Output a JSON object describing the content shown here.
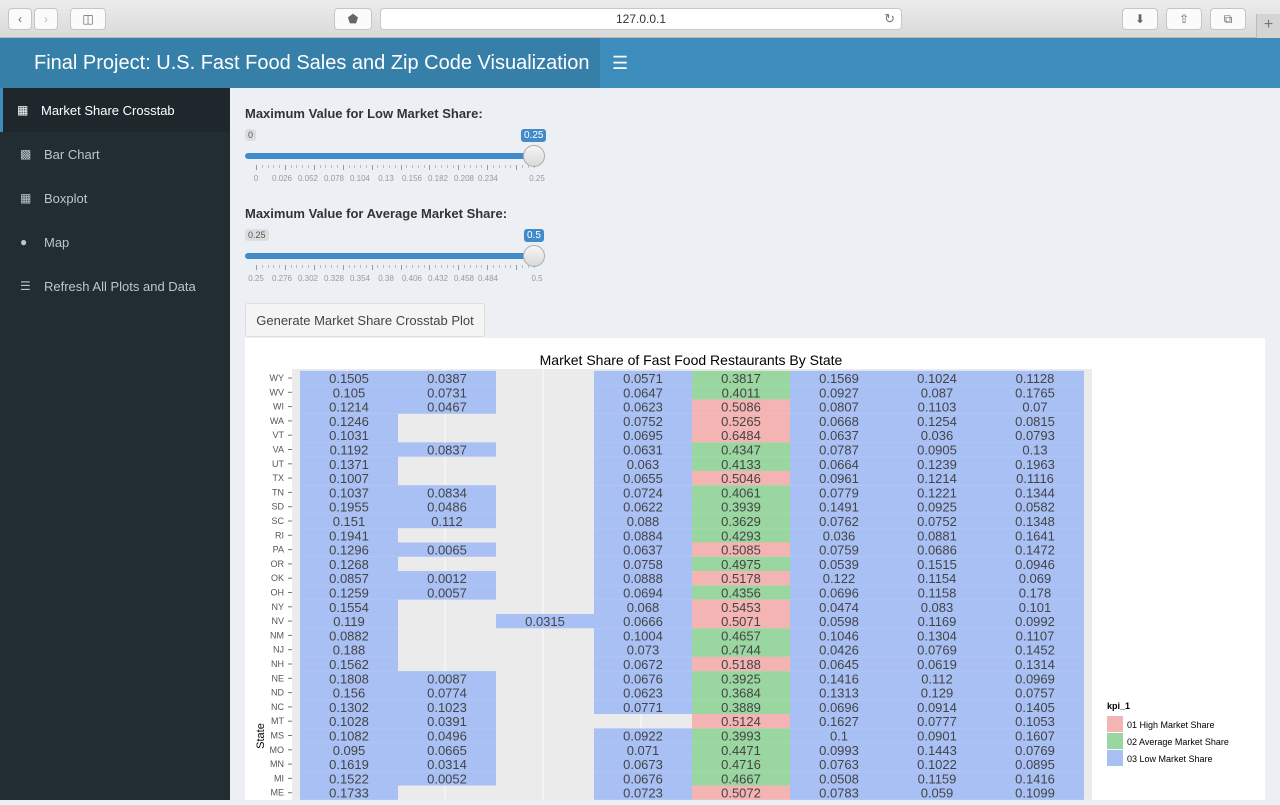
{
  "browser": {
    "url": "127.0.0.1"
  },
  "header": {
    "title": "Final Project: U.S. Fast Food Sales and Zip Code Visualization",
    "toggle_icon": "hamburger-icon"
  },
  "sidebar": {
    "items": [
      {
        "label": "Market Share Crosstab",
        "icon": "grid-icon",
        "active": true
      },
      {
        "label": "Bar Chart",
        "icon": "bar-chart-icon",
        "active": false
      },
      {
        "label": "Boxplot",
        "icon": "grid-icon",
        "active": false
      },
      {
        "label": "Map",
        "icon": "map-marker-icon",
        "active": false
      },
      {
        "label": "Refresh All Plots and Data",
        "icon": "database-icon",
        "active": false
      }
    ]
  },
  "sliders": [
    {
      "label": "Maximum Value for Low Market Share:",
      "min_label": "0",
      "value_label": "0.25",
      "value": 0.25,
      "min": 0,
      "max": 0.25,
      "tick_labels": [
        "0",
        "0.026",
        "0.052",
        "0.078",
        "0.104",
        "0.13",
        "0.156",
        "0.182",
        "0.208",
        "0.234",
        "0.25"
      ]
    },
    {
      "label": "Maximum Value for Average Market Share:",
      "min_label": "0.25",
      "value_label": "0.5",
      "value": 0.5,
      "min": 0.25,
      "max": 0.5,
      "tick_labels": [
        "0.25",
        "0.276",
        "0.302",
        "0.328",
        "0.354",
        "0.38",
        "0.406",
        "0.432",
        "0.458",
        "0.484",
        "0.5"
      ]
    }
  ],
  "generate_button": "Generate Market Share Crosstab Plot",
  "colors": {
    "high": "#f4b4b4",
    "average": "#99d6a0",
    "low": "#a9c0f5",
    "empty": "#ebebeb"
  },
  "chart_data": {
    "type": "heatmap",
    "title": "Market Share of Fast Food Restaurants By State",
    "ylabel": "State",
    "legend_title": "kpi_1",
    "legend": [
      {
        "label": "01 High Market Share",
        "key": "high"
      },
      {
        "label": "02 Average Market Share",
        "key": "average"
      },
      {
        "label": "03 Low Market Share",
        "key": "low"
      }
    ],
    "rows": [
      {
        "state": "WY",
        "cells": [
          "0.1505",
          "0.0387",
          null,
          "0.0571",
          "0.3817",
          "0.1569",
          "0.1024",
          "0.1128"
        ],
        "kpi": [
          "low",
          "low",
          null,
          "low",
          "average",
          "low",
          "low",
          "low"
        ]
      },
      {
        "state": "WV",
        "cells": [
          "0.105",
          "0.0731",
          null,
          "0.0647",
          "0.4011",
          "0.0927",
          "0.087",
          "0.1765"
        ],
        "kpi": [
          "low",
          "low",
          null,
          "low",
          "average",
          "low",
          "low",
          "low"
        ]
      },
      {
        "state": "WI",
        "cells": [
          "0.1214",
          "0.0467",
          null,
          "0.0623",
          "0.5086",
          "0.0807",
          "0.1103",
          "0.07"
        ],
        "kpi": [
          "low",
          "low",
          null,
          "low",
          "high",
          "low",
          "low",
          "low"
        ]
      },
      {
        "state": "WA",
        "cells": [
          "0.1246",
          null,
          null,
          "0.0752",
          "0.5265",
          "0.0668",
          "0.1254",
          "0.0815"
        ],
        "kpi": [
          "low",
          null,
          null,
          "low",
          "high",
          "low",
          "low",
          "low"
        ]
      },
      {
        "state": "VT",
        "cells": [
          "0.1031",
          null,
          null,
          "0.0695",
          "0.6484",
          "0.0637",
          "0.036",
          "0.0793"
        ],
        "kpi": [
          "low",
          null,
          null,
          "low",
          "high",
          "low",
          "low",
          "low"
        ]
      },
      {
        "state": "VA",
        "cells": [
          "0.1192",
          "0.0837",
          null,
          "0.0631",
          "0.4347",
          "0.0787",
          "0.0905",
          "0.13"
        ],
        "kpi": [
          "low",
          "low",
          null,
          "low",
          "average",
          "low",
          "low",
          "low"
        ]
      },
      {
        "state": "UT",
        "cells": [
          "0.1371",
          null,
          null,
          "0.063",
          "0.4133",
          "0.0664",
          "0.1239",
          "0.1963"
        ],
        "kpi": [
          "low",
          null,
          null,
          "low",
          "average",
          "low",
          "low",
          "low"
        ]
      },
      {
        "state": "TX",
        "cells": [
          "0.1007",
          null,
          null,
          "0.0655",
          "0.5046",
          "0.0961",
          "0.1214",
          "0.1116"
        ],
        "kpi": [
          "low",
          null,
          null,
          "low",
          "high",
          "low",
          "low",
          "low"
        ]
      },
      {
        "state": "TN",
        "cells": [
          "0.1037",
          "0.0834",
          null,
          "0.0724",
          "0.4061",
          "0.0779",
          "0.1221",
          "0.1344"
        ],
        "kpi": [
          "low",
          "low",
          null,
          "low",
          "average",
          "low",
          "low",
          "low"
        ]
      },
      {
        "state": "SD",
        "cells": [
          "0.1955",
          "0.0486",
          null,
          "0.0622",
          "0.3939",
          "0.1491",
          "0.0925",
          "0.0582"
        ],
        "kpi": [
          "low",
          "low",
          null,
          "low",
          "average",
          "low",
          "low",
          "low"
        ]
      },
      {
        "state": "SC",
        "cells": [
          "0.151",
          "0.112",
          null,
          "0.088",
          "0.3629",
          "0.0762",
          "0.0752",
          "0.1348"
        ],
        "kpi": [
          "low",
          "low",
          null,
          "low",
          "average",
          "low",
          "low",
          "low"
        ]
      },
      {
        "state": "RI",
        "cells": [
          "0.1941",
          null,
          null,
          "0.0884",
          "0.4293",
          "0.036",
          "0.0881",
          "0.1641"
        ],
        "kpi": [
          "low",
          null,
          null,
          "low",
          "average",
          "low",
          "low",
          "low"
        ]
      },
      {
        "state": "PA",
        "cells": [
          "0.1296",
          "0.0065",
          null,
          "0.0637",
          "0.5085",
          "0.0759",
          "0.0686",
          "0.1472"
        ],
        "kpi": [
          "low",
          "low",
          null,
          "low",
          "high",
          "low",
          "low",
          "low"
        ]
      },
      {
        "state": "OR",
        "cells": [
          "0.1268",
          null,
          null,
          "0.0758",
          "0.4975",
          "0.0539",
          "0.1515",
          "0.0946"
        ],
        "kpi": [
          "low",
          null,
          null,
          "low",
          "average",
          "low",
          "low",
          "low"
        ]
      },
      {
        "state": "OK",
        "cells": [
          "0.0857",
          "0.0012",
          null,
          "0.0888",
          "0.5178",
          "0.122",
          "0.1154",
          "0.069"
        ],
        "kpi": [
          "low",
          "low",
          null,
          "low",
          "high",
          "low",
          "low",
          "low"
        ]
      },
      {
        "state": "OH",
        "cells": [
          "0.1259",
          "0.0057",
          null,
          "0.0694",
          "0.4356",
          "0.0696",
          "0.1158",
          "0.178"
        ],
        "kpi": [
          "low",
          "low",
          null,
          "low",
          "average",
          "low",
          "low",
          "low"
        ]
      },
      {
        "state": "NY",
        "cells": [
          "0.1554",
          null,
          null,
          "0.068",
          "0.5453",
          "0.0474",
          "0.083",
          "0.101"
        ],
        "kpi": [
          "low",
          null,
          null,
          "low",
          "high",
          "low",
          "low",
          "low"
        ]
      },
      {
        "state": "NV",
        "cells": [
          "0.119",
          null,
          "0.0315",
          "0.0666",
          "0.5071",
          "0.0598",
          "0.1169",
          "0.0992"
        ],
        "kpi": [
          "low",
          null,
          "low",
          "low",
          "high",
          "low",
          "low",
          "low"
        ]
      },
      {
        "state": "NM",
        "cells": [
          "0.0882",
          null,
          null,
          "0.1004",
          "0.4657",
          "0.1046",
          "0.1304",
          "0.1107"
        ],
        "kpi": [
          "low",
          null,
          null,
          "low",
          "average",
          "low",
          "low",
          "low"
        ]
      },
      {
        "state": "NJ",
        "cells": [
          "0.188",
          null,
          null,
          "0.073",
          "0.4744",
          "0.0426",
          "0.0769",
          "0.1452"
        ],
        "kpi": [
          "low",
          null,
          null,
          "low",
          "average",
          "low",
          "low",
          "low"
        ]
      },
      {
        "state": "NH",
        "cells": [
          "0.1562",
          null,
          null,
          "0.0672",
          "0.5188",
          "0.0645",
          "0.0619",
          "0.1314"
        ],
        "kpi": [
          "low",
          null,
          null,
          "low",
          "high",
          "low",
          "low",
          "low"
        ]
      },
      {
        "state": "NE",
        "cells": [
          "0.1808",
          "0.0087",
          null,
          "0.0676",
          "0.3925",
          "0.1416",
          "0.112",
          "0.0969"
        ],
        "kpi": [
          "low",
          "low",
          null,
          "low",
          "average",
          "low",
          "low",
          "low"
        ]
      },
      {
        "state": "ND",
        "cells": [
          "0.156",
          "0.0774",
          null,
          "0.0623",
          "0.3684",
          "0.1313",
          "0.129",
          "0.0757"
        ],
        "kpi": [
          "low",
          "low",
          null,
          "low",
          "average",
          "low",
          "low",
          "low"
        ]
      },
      {
        "state": "NC",
        "cells": [
          "0.1302",
          "0.1023",
          null,
          "0.0771",
          "0.3889",
          "0.0696",
          "0.0914",
          "0.1405"
        ],
        "kpi": [
          "low",
          "low",
          null,
          "low",
          "average",
          "low",
          "low",
          "low"
        ]
      },
      {
        "state": "MT",
        "cells": [
          "0.1028",
          "0.0391",
          null,
          null,
          "0.5124",
          "0.1627",
          "0.0777",
          "0.1053"
        ],
        "kpi": [
          "low",
          "low",
          null,
          null,
          "high",
          "low",
          "low",
          "low"
        ]
      },
      {
        "state": "MS",
        "cells": [
          "0.1082",
          "0.0496",
          null,
          "0.0922",
          "0.3993",
          "0.1",
          "0.0901",
          "0.1607"
        ],
        "kpi": [
          "low",
          "low",
          null,
          "low",
          "average",
          "low",
          "low",
          "low"
        ]
      },
      {
        "state": "MO",
        "cells": [
          "0.095",
          "0.0665",
          null,
          "0.071",
          "0.4471",
          "0.0993",
          "0.1443",
          "0.0769"
        ],
        "kpi": [
          "low",
          "low",
          null,
          "low",
          "average",
          "low",
          "low",
          "low"
        ]
      },
      {
        "state": "MN",
        "cells": [
          "0.1619",
          "0.0314",
          null,
          "0.0673",
          "0.4716",
          "0.0763",
          "0.1022",
          "0.0895"
        ],
        "kpi": [
          "low",
          "low",
          null,
          "low",
          "average",
          "low",
          "low",
          "low"
        ]
      },
      {
        "state": "MI",
        "cells": [
          "0.1522",
          "0.0052",
          null,
          "0.0676",
          "0.4667",
          "0.0508",
          "0.1159",
          "0.1416"
        ],
        "kpi": [
          "low",
          "low",
          null,
          "low",
          "average",
          "low",
          "low",
          "low"
        ]
      },
      {
        "state": "ME",
        "cells": [
          "0.1733",
          null,
          null,
          "0.0723",
          "0.5072",
          "0.0783",
          "0.059",
          "0.1099"
        ],
        "kpi": [
          "low",
          null,
          null,
          "low",
          "high",
          "low",
          "low",
          "low"
        ]
      }
    ]
  }
}
